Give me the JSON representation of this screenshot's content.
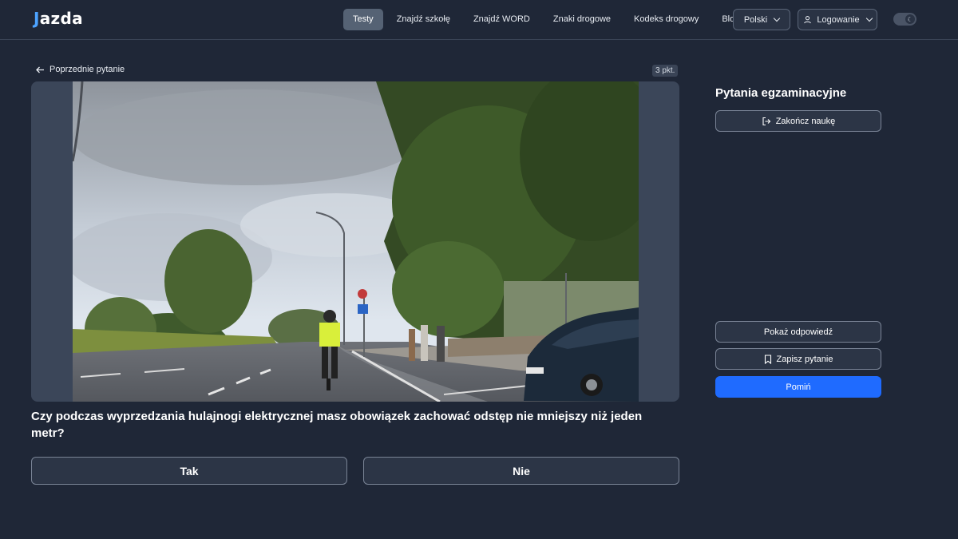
{
  "header": {
    "logo_letter": "J",
    "logo_rest": "azda",
    "nav": [
      "Testy",
      "Znajdź szkołę",
      "Znajdź WORD",
      "Znaki drogowe",
      "Kodeks drogowy",
      "Blog"
    ],
    "language": "Polski",
    "login": "Logowanie"
  },
  "main": {
    "prev_label": "Poprzednie pytanie",
    "points": "3 pkt.",
    "question": "Czy podczas wyprzedzania hulajnogi elektrycznej masz obowiązek zachować odstęp nie mniejszy niż jeden metr?",
    "answers": [
      "Tak",
      "Nie"
    ]
  },
  "side": {
    "title": "Pytania egzaminacyjne",
    "end_label": "Zakończ naukę",
    "show_answer": "Pokaż odpowiedź",
    "save_question": "Zapisz pytanie",
    "skip": "Pomiń"
  },
  "colors": {
    "background": "#1f2737",
    "accent": "#1f6bff",
    "logo_accent": "#4da3ff"
  }
}
